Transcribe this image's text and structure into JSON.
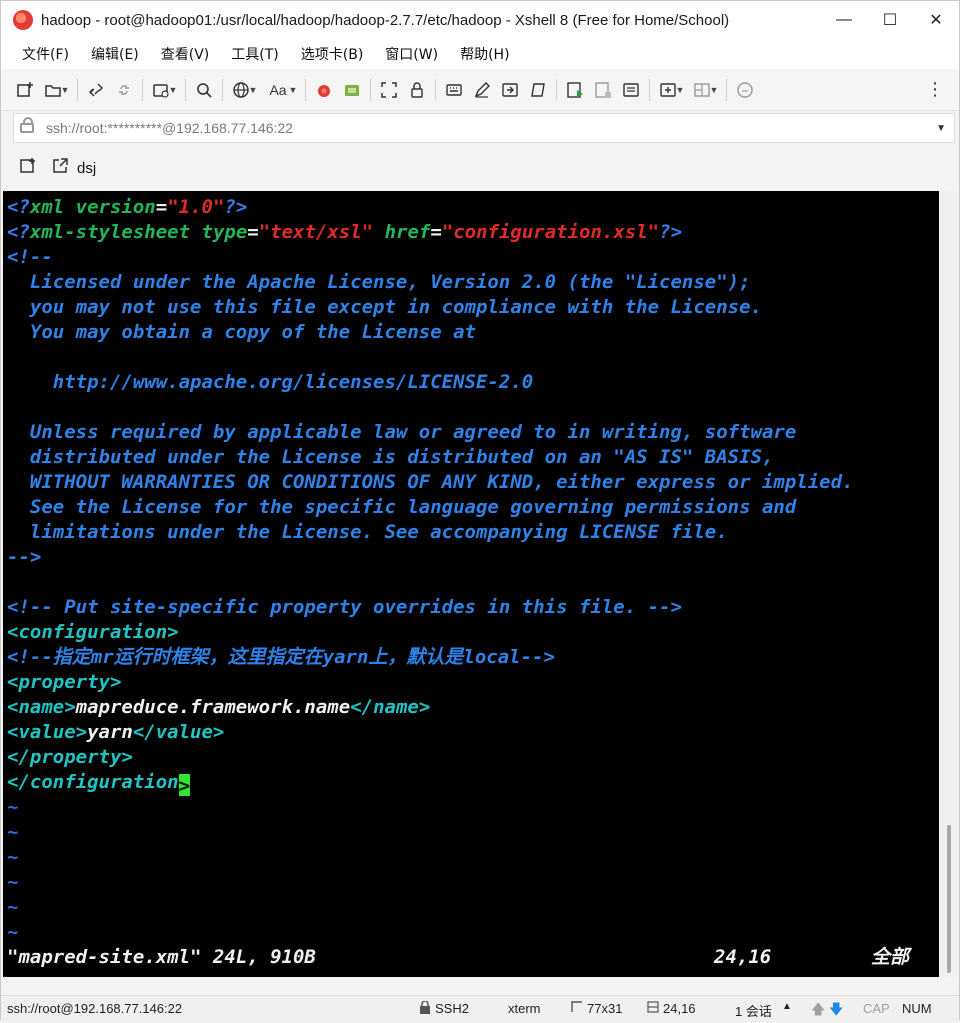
{
  "window": {
    "title": "hadoop - root@hadoop01:/usr/local/hadoop/hadoop-2.7.7/etc/hadoop - Xshell 8 (Free for Home/School)",
    "minimize": "—",
    "maximize": "☐",
    "close": "✕"
  },
  "menu": [
    "文件(F)",
    "编辑(E)",
    "查看(V)",
    "工具(T)",
    "选项卡(B)",
    "窗口(W)",
    "帮助(H)"
  ],
  "address": {
    "text": "ssh://root:**********@192.168.77.146:22",
    "dropdown": "▼"
  },
  "session_tab": {
    "label": "dsj"
  },
  "editor": {
    "lines": [
      "<?xml version=\"1.0\"?>",
      "<?xml-stylesheet type=\"text/xsl\" href=\"configuration.xsl\"?>",
      "<!--",
      "  Licensed under the Apache License, Version 2.0 (the \"License\");",
      "  you may not use this file except in compliance with the License.",
      "  You may obtain a copy of the License at",
      "",
      "    http://www.apache.org/licenses/LICENSE-2.0",
      "",
      "  Unless required by applicable law or agreed to in writing, software",
      "  distributed under the License is distributed on an \"AS IS\" BASIS,",
      "  WITHOUT WARRANTIES OR CONDITIONS OF ANY KIND, either express or implied.",
      "  See the License for the specific language governing permissions and",
      "  limitations under the License. See accompanying LICENSE file.",
      "-->",
      "",
      "<!-- Put site-specific property overrides in this file. -->",
      "<configuration>",
      "<!--指定mr运行时框架，这里指定在yarn上，默认是local-->",
      "<property>",
      "<name>mapreduce.framework.name</name>",
      "<value>yarn</value>",
      "</property>",
      "</configuration>"
    ],
    "tildes": [
      "~",
      "~",
      "~",
      "~",
      "~",
      "~"
    ],
    "status_file": "\"mapred-site.xml\" 24L, 910B",
    "status_pos": "24,16",
    "status_all": "全部"
  },
  "statusbar": {
    "connection": "ssh://root@192.168.77.146:22",
    "protocol": "SSH2",
    "term": "xterm",
    "size": "77x31",
    "cursor": "24,16",
    "sessions": "1 会话",
    "caps": "CAP",
    "num": "NUM"
  }
}
